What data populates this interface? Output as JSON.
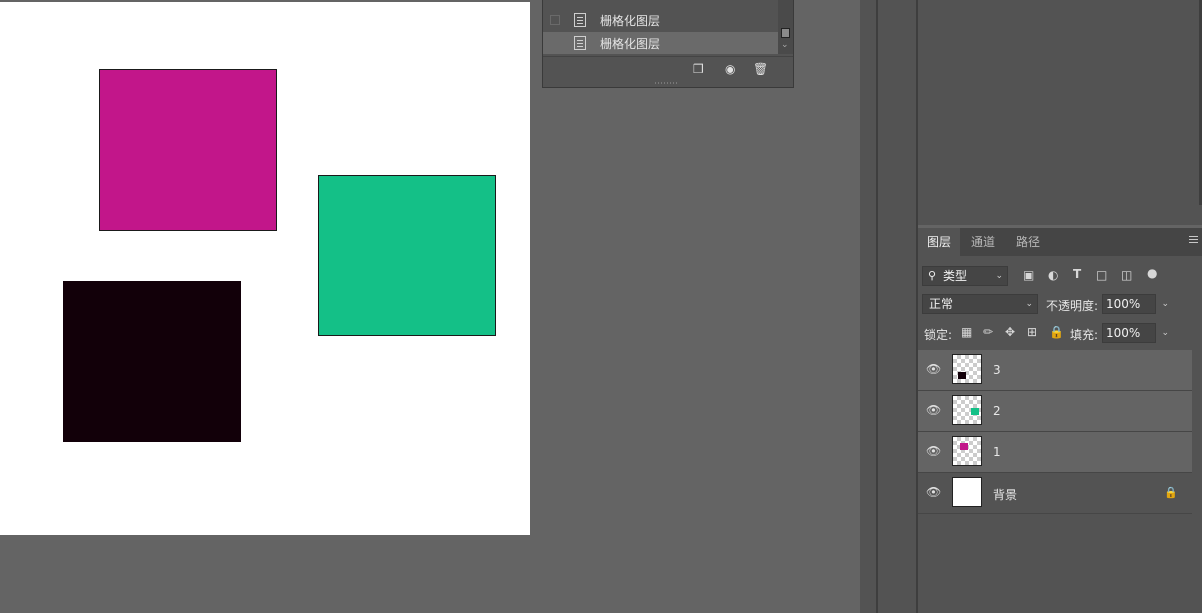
{
  "canvas": {
    "squares": [
      {
        "name": "magenta",
        "color": "#c2168a"
      },
      {
        "name": "green",
        "color": "#14c087"
      },
      {
        "name": "black",
        "color": "#120009"
      }
    ]
  },
  "history": {
    "items": [
      {
        "label": "栅格化图层",
        "selected": false
      },
      {
        "label": "栅格化图层",
        "selected": true
      }
    ],
    "toolbar": [
      "new-document-from-state-icon",
      "camera-icon",
      "trash-icon"
    ]
  },
  "layers_panel": {
    "tabs": [
      "图层",
      "通道",
      "路径"
    ],
    "filter": {
      "label": "类型"
    },
    "blend_mode": "正常",
    "opacity_label": "不透明度:",
    "opacity_value": "100%",
    "lock_label": "锁定:",
    "fill_label": "填充:",
    "fill_value": "100%",
    "layers": [
      {
        "name": "3",
        "thumb_color": "#120009"
      },
      {
        "name": "2",
        "thumb_color": "#14c087"
      },
      {
        "name": "1",
        "thumb_color": "#c2168a"
      },
      {
        "name": "背景",
        "locked": true
      }
    ]
  }
}
